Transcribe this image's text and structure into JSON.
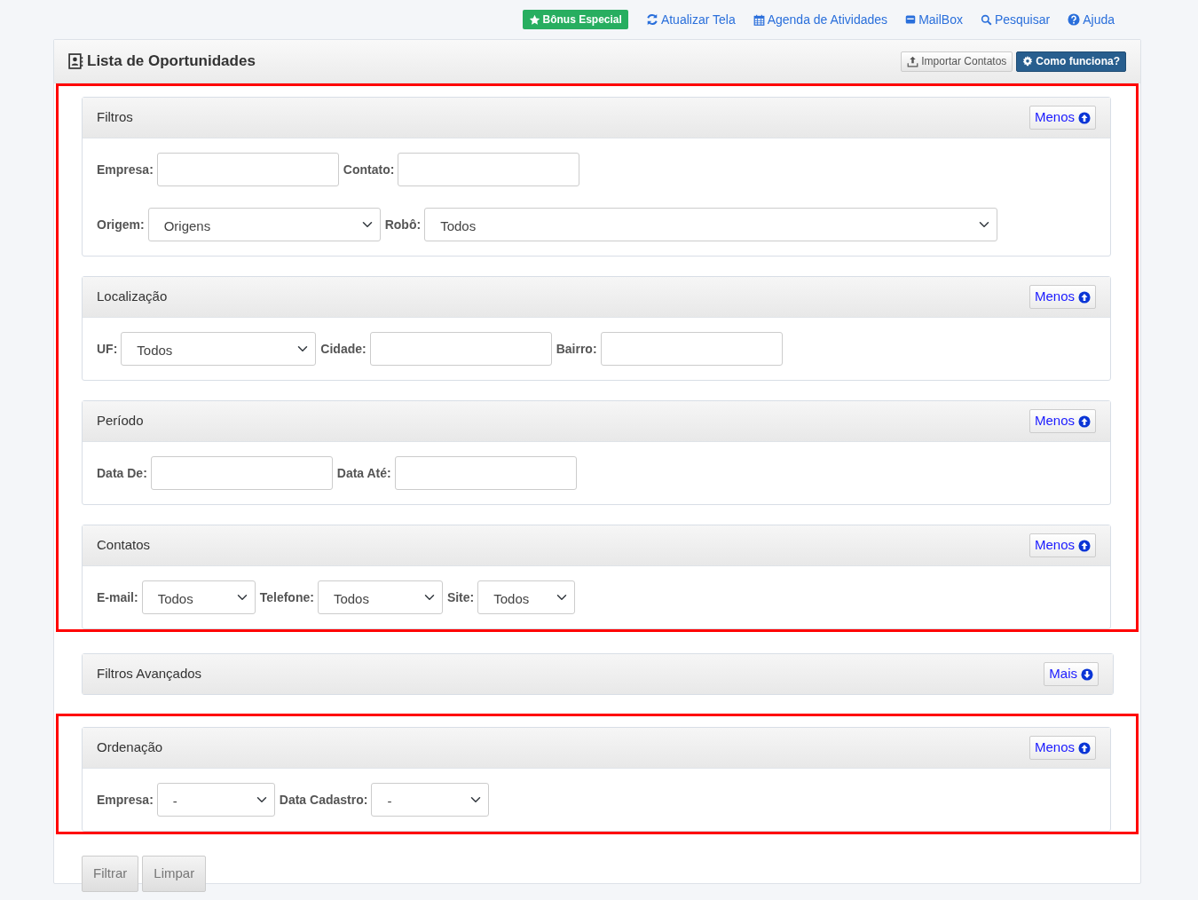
{
  "top_links": [
    {
      "kind": "badge",
      "label": "Bônus Especial"
    },
    {
      "kind": "link",
      "label": "Atualizar Tela"
    },
    {
      "kind": "link",
      "label": "Agenda de Atividades"
    },
    {
      "kind": "link",
      "label": "MailBox"
    },
    {
      "kind": "link",
      "label": "Pesquisar"
    },
    {
      "kind": "link",
      "label": "Ajuda"
    }
  ],
  "card": {
    "title": "Lista de Oportunidades",
    "buttons": [
      {
        "kind": "default",
        "label": "Importar Contatos"
      },
      {
        "kind": "primary",
        "label": "Como funciona?"
      }
    ]
  },
  "sections": [
    {
      "title": "Filtros",
      "toggle": "Menos",
      "expanded": true,
      "highlighted": true,
      "rows": [
        [
          {
            "label": "Empresa:",
            "kind": "text"
          },
          {
            "label": "Contato:",
            "kind": "text"
          }
        ],
        [
          {
            "label": "Origem:",
            "kind": "select",
            "value": "Origens"
          },
          {
            "label": "Robô:",
            "kind": "select",
            "value": "Todos"
          }
        ]
      ]
    },
    {
      "title": "Localização",
      "toggle": "Menos",
      "expanded": true,
      "highlighted": true,
      "rows": [
        [
          {
            "label": "UF:",
            "kind": "select",
            "value": "Todos"
          },
          {
            "label": "Cidade:",
            "kind": "text"
          },
          {
            "label": "Bairro:",
            "kind": "text"
          }
        ]
      ]
    },
    {
      "title": "Período",
      "toggle": "Menos",
      "expanded": true,
      "highlighted": true,
      "rows": [
        [
          {
            "label": "Data De:",
            "kind": "text"
          },
          {
            "label": "Data Até:",
            "kind": "text"
          }
        ]
      ]
    },
    {
      "title": "Contatos",
      "toggle": "Menos",
      "expanded": true,
      "highlighted": true,
      "rows": [
        [
          {
            "label": "E-mail:",
            "kind": "select",
            "value": "Todos"
          },
          {
            "label": "Telefone:",
            "kind": "select",
            "value": "Todos"
          },
          {
            "label": "Site:",
            "kind": "select",
            "value": "Todos"
          }
        ]
      ]
    },
    {
      "title": "Filtros Avançados",
      "toggle": "Mais",
      "expanded": false,
      "highlighted": false
    },
    {
      "title": "Ordenação",
      "toggle": "Menos",
      "expanded": true,
      "highlighted": true,
      "rows": [
        [
          {
            "label": "Empresa:",
            "kind": "select",
            "value": "-"
          },
          {
            "label": "Data Cadastro:",
            "kind": "select",
            "value": "-"
          }
        ]
      ]
    }
  ],
  "actions": [
    "Filtrar",
    "Limpar"
  ]
}
